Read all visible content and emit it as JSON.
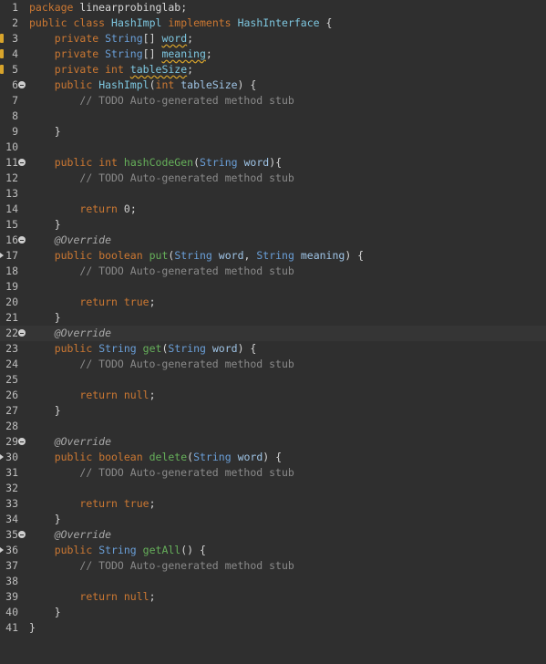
{
  "editor": {
    "lines": [
      {
        "n": "1",
        "text": "package linearprobinglab;"
      },
      {
        "n": "2",
        "text": "public class HashImpl implements HashInterface {"
      },
      {
        "n": "3",
        "text": "private String[] word;"
      },
      {
        "n": "4",
        "text": "private String[] meaning;"
      },
      {
        "n": "5",
        "text": "private int tableSize;"
      },
      {
        "n": "6",
        "text": "public HashImpl(int tableSize) {"
      },
      {
        "n": "7",
        "text": "// TODO Auto-generated method stub"
      },
      {
        "n": "8",
        "text": ""
      },
      {
        "n": "9",
        "text": "}"
      },
      {
        "n": "10",
        "text": ""
      },
      {
        "n": "11",
        "text": "public int hashCodeGen(String word){"
      },
      {
        "n": "12",
        "text": "// TODO Auto-generated method stub"
      },
      {
        "n": "13",
        "text": ""
      },
      {
        "n": "14",
        "text": "return 0;"
      },
      {
        "n": "15",
        "text": "}"
      },
      {
        "n": "16",
        "text": "@Override"
      },
      {
        "n": "17",
        "text": "public boolean put(String word, String meaning) {"
      },
      {
        "n": "18",
        "text": "// TODO Auto-generated method stub"
      },
      {
        "n": "19",
        "text": ""
      },
      {
        "n": "20",
        "text": "return true;"
      },
      {
        "n": "21",
        "text": "}"
      },
      {
        "n": "22",
        "text": "@Override"
      },
      {
        "n": "23",
        "text": "public String get(String word) {"
      },
      {
        "n": "24",
        "text": "// TODO Auto-generated method stub"
      },
      {
        "n": "25",
        "text": ""
      },
      {
        "n": "26",
        "text": "return null;"
      },
      {
        "n": "27",
        "text": "}"
      },
      {
        "n": "28",
        "text": ""
      },
      {
        "n": "29",
        "text": "@Override"
      },
      {
        "n": "30",
        "text": "public boolean delete(String word) {"
      },
      {
        "n": "31",
        "text": "// TODO Auto-generated method stub"
      },
      {
        "n": "32",
        "text": ""
      },
      {
        "n": "33",
        "text": "return true;"
      },
      {
        "n": "34",
        "text": "}"
      },
      {
        "n": "35",
        "text": "@Override"
      },
      {
        "n": "36",
        "text": "public String getAll() {"
      },
      {
        "n": "37",
        "text": "// TODO Auto-generated method stub"
      },
      {
        "n": "38",
        "text": ""
      },
      {
        "n": "39",
        "text": "return null;"
      },
      {
        "n": "40",
        "text": "}"
      },
      {
        "n": "41",
        "text": "}"
      }
    ],
    "current_line": "22",
    "folded_lines": [
      "6",
      "11",
      "16",
      "22",
      "29",
      "35"
    ],
    "warning_lines": [
      "3",
      "4",
      "5"
    ],
    "override_lines": [
      "17",
      "30",
      "36"
    ],
    "colors": {
      "background": "#2f2f2f",
      "keyword": "#cc7832",
      "type": "#6a9fd8",
      "method": "#66b05a",
      "comment": "#8a8a8a"
    }
  }
}
